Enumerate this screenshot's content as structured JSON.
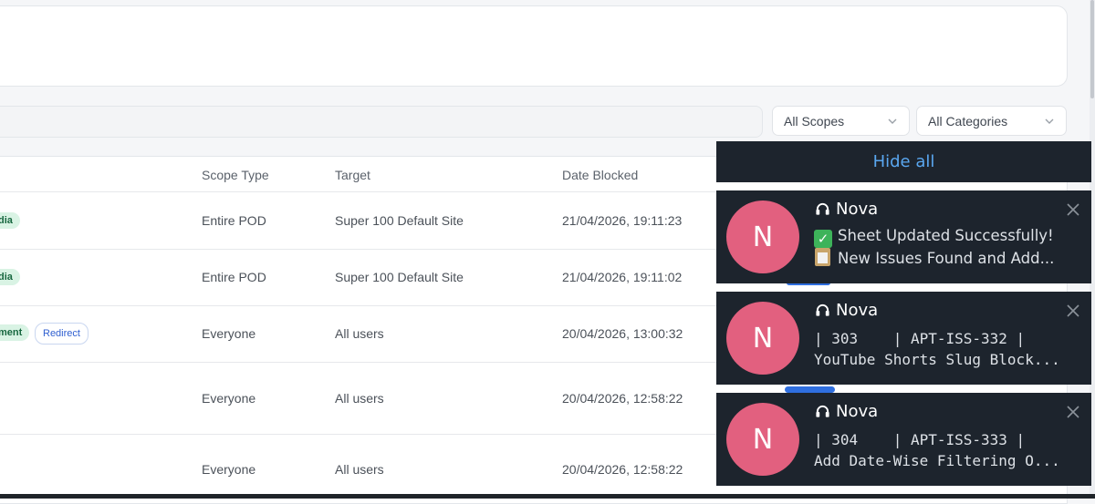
{
  "filters": {
    "scopes_value": "All Scopes",
    "categories_value": "All Categories"
  },
  "table": {
    "headers": {
      "scope_type": "Scope Type",
      "target": "Target",
      "date_blocked": "Date Blocked"
    },
    "rows": [
      {
        "tag": "dia",
        "tag2": "",
        "scope_type": "Entire POD",
        "target": "Super 100 Default Site",
        "date": "21/04/2026, 19:11:23"
      },
      {
        "tag": "dia",
        "tag2": "",
        "scope_type": "Entire POD",
        "target": "Super 100 Default Site",
        "date": "21/04/2026, 19:11:02"
      },
      {
        "tag": "ment",
        "tag2": "Redirect",
        "scope_type": "Everyone",
        "target": "All users",
        "date": "20/04/2026, 13:00:32"
      },
      {
        "tag": "",
        "tag2": "",
        "scope_type": "Everyone",
        "target": "All users",
        "date": "20/04/2026, 12:58:22"
      },
      {
        "tag": "",
        "tag2": "",
        "scope_type": "Everyone",
        "target": "All users",
        "date": "20/04/2026, 12:58:22"
      }
    ]
  },
  "notifications": {
    "hide_all_label": "Hide all",
    "items": [
      {
        "avatar": "N",
        "sender": "Nova",
        "line1": "Sheet Updated Successfully!",
        "line2": "New Issues Found and Add..."
      },
      {
        "avatar": "N",
        "sender": "Nova",
        "line1": "| 303    | APT-ISS-332 |",
        "line2": "YouTube Shorts Slug Block..."
      },
      {
        "avatar": "N",
        "sender": "Nova",
        "line1": "| 304    | APT-ISS-333 |",
        "line2": "Add Date-Wise Filtering O..."
      }
    ]
  },
  "colors": {
    "notification_bg": "#1d242d",
    "avatar": "#e2607f",
    "hide_all_text": "#5aa7f0",
    "pill_green_bg": "#d9f3e4",
    "pill_green_text": "#17673f"
  },
  "icons": {
    "select_arrow": "chevron-down-icon",
    "close": "close-icon",
    "sender": "headset-icon",
    "check_emoji": "check-mark-emoji-icon",
    "clipboard_emoji": "clipboard-emoji-icon"
  }
}
